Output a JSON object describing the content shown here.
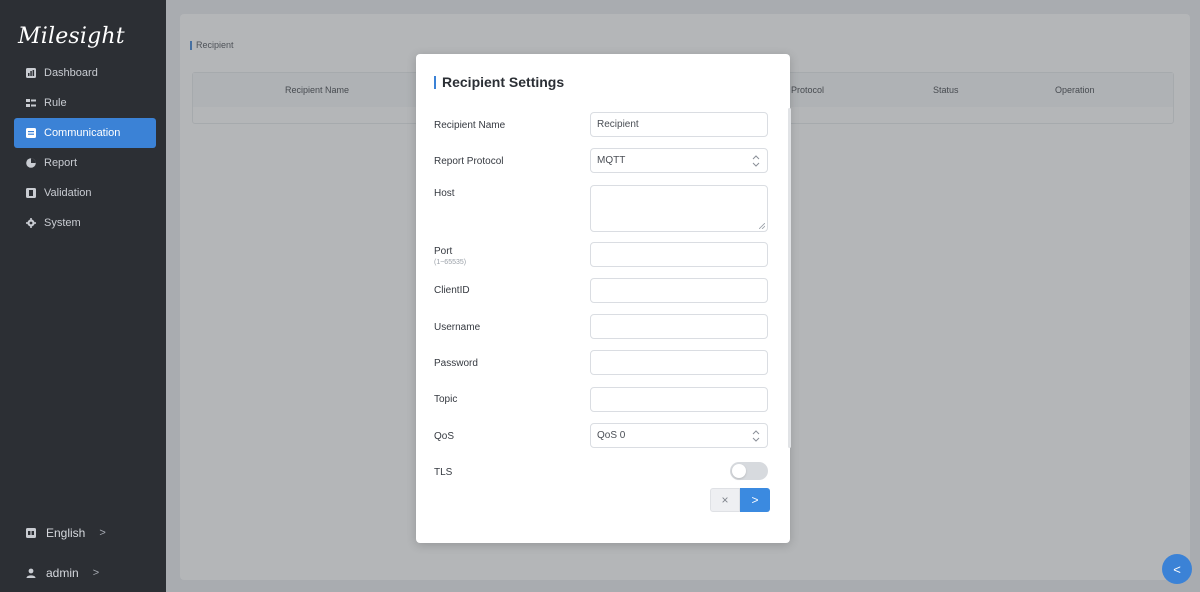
{
  "app": {
    "logo_text": "Milesight"
  },
  "sidebar": {
    "items": [
      {
        "label": "Dashboard",
        "icon": "dashboard-icon"
      },
      {
        "label": "Rule",
        "icon": "rule-icon"
      },
      {
        "label": "Communication",
        "icon": "communication-icon",
        "active": true
      },
      {
        "label": "Report",
        "icon": "report-icon"
      },
      {
        "label": "Validation",
        "icon": "validation-icon"
      },
      {
        "label": "System",
        "icon": "system-icon"
      }
    ],
    "language": {
      "label": "English",
      "icon": "language-icon",
      "chevron": ">"
    },
    "user": {
      "label": "admin",
      "icon": "user-icon",
      "chevron": ">"
    }
  },
  "page": {
    "breadcrumb": "Recipient",
    "table": {
      "columns": [
        "Recipient Name",
        "Protocol",
        "Status",
        "Operation"
      ]
    }
  },
  "modal": {
    "title": "Recipient Settings",
    "fields": {
      "recipient_name": {
        "label": "Recipient Name",
        "value": "Recipient"
      },
      "report_protocol": {
        "label": "Report Protocol",
        "value": "MQTT"
      },
      "host": {
        "label": "Host",
        "value": ""
      },
      "port": {
        "label": "Port",
        "hint": "(1~65535)",
        "value": ""
      },
      "client_id": {
        "label": "ClientID",
        "value": ""
      },
      "username": {
        "label": "Username",
        "value": ""
      },
      "password": {
        "label": "Password",
        "value": ""
      },
      "topic": {
        "label": "Topic",
        "value": ""
      },
      "qos": {
        "label": "QoS",
        "value": "QoS 0"
      },
      "tls": {
        "label": "TLS",
        "enabled": false
      }
    },
    "buttons": {
      "cancel": "×",
      "next": ">"
    }
  },
  "fab": {
    "icon": "chevron-left-icon",
    "label": "<"
  },
  "colors": {
    "accent": "#3b82d6",
    "sidebar_bg": "#2c2f34"
  }
}
